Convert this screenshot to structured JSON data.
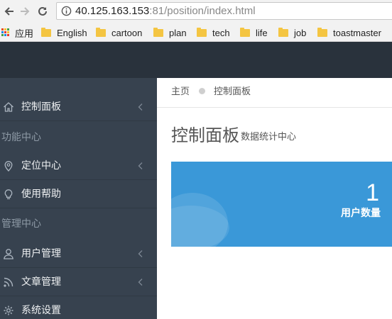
{
  "browser": {
    "url_host": "40.125.163.153",
    "url_rest": ":81/position/index.html",
    "bookmarks": [
      {
        "label": "应用"
      },
      {
        "label": "English"
      },
      {
        "label": "cartoon"
      },
      {
        "label": "plan"
      },
      {
        "label": "tech"
      },
      {
        "label": "life"
      },
      {
        "label": "job"
      },
      {
        "label": "toastmaster"
      }
    ]
  },
  "sidebar": {
    "items": [
      {
        "label": "控制面板",
        "icon": "home-icon"
      },
      {
        "header": "功能中心"
      },
      {
        "label": "定位中心",
        "icon": "map-pin-icon"
      },
      {
        "label": "使用帮助",
        "icon": "lightbulb-icon"
      },
      {
        "header": "管理中心"
      },
      {
        "label": "用户管理",
        "icon": "user-icon"
      },
      {
        "label": "文章管理",
        "icon": "rss-icon"
      },
      {
        "label": "系统设置",
        "icon": "gear-icon"
      }
    ]
  },
  "breadcrumb": {
    "home": "主页",
    "current": "控制面板"
  },
  "page": {
    "title": "控制面板",
    "subtitle": "数据统计中心"
  },
  "stat_card": {
    "value": "1",
    "label": "用户数量",
    "color": "#3a98d8"
  },
  "colors": {
    "header": "#29323c",
    "sidebar": "#37424f"
  }
}
